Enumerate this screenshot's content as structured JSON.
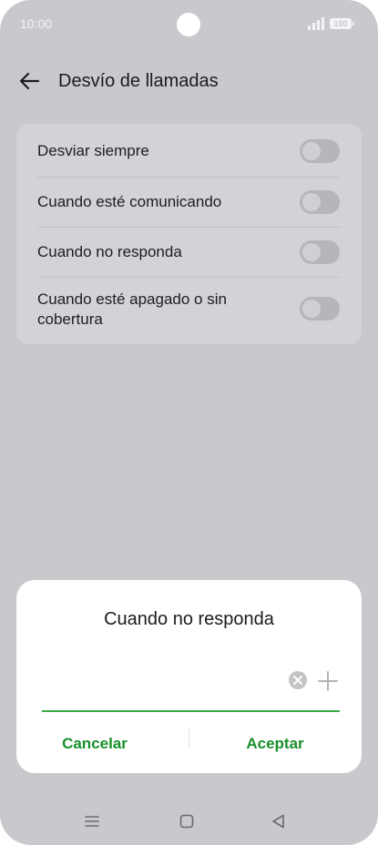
{
  "status_bar": {
    "time": "10:00",
    "battery": "100"
  },
  "header": {
    "title": "Desvío de llamadas"
  },
  "settings": {
    "rows": [
      {
        "label": "Desviar siempre",
        "enabled": false
      },
      {
        "label": "Cuando esté comunicando",
        "enabled": false
      },
      {
        "label": "Cuando no responda",
        "enabled": false
      },
      {
        "label": "Cuando esté apagado o sin cobertura",
        "enabled": false
      }
    ]
  },
  "dialog": {
    "title": "Cuando no responda",
    "input_value": "",
    "cancel_label": "Cancelar",
    "accept_label": "Aceptar"
  },
  "icons": {
    "back": "arrow-left-icon",
    "clear": "clear-circle-icon",
    "add_contact": "plus-icon",
    "nav_menu": "menu-icon",
    "nav_home": "square-home-icon",
    "nav_back": "triangle-back-icon"
  },
  "colors": {
    "background": "#c8c9cc",
    "card": "#d2d3d6",
    "accent": "#17902a",
    "input_underline": "#3aa845"
  }
}
